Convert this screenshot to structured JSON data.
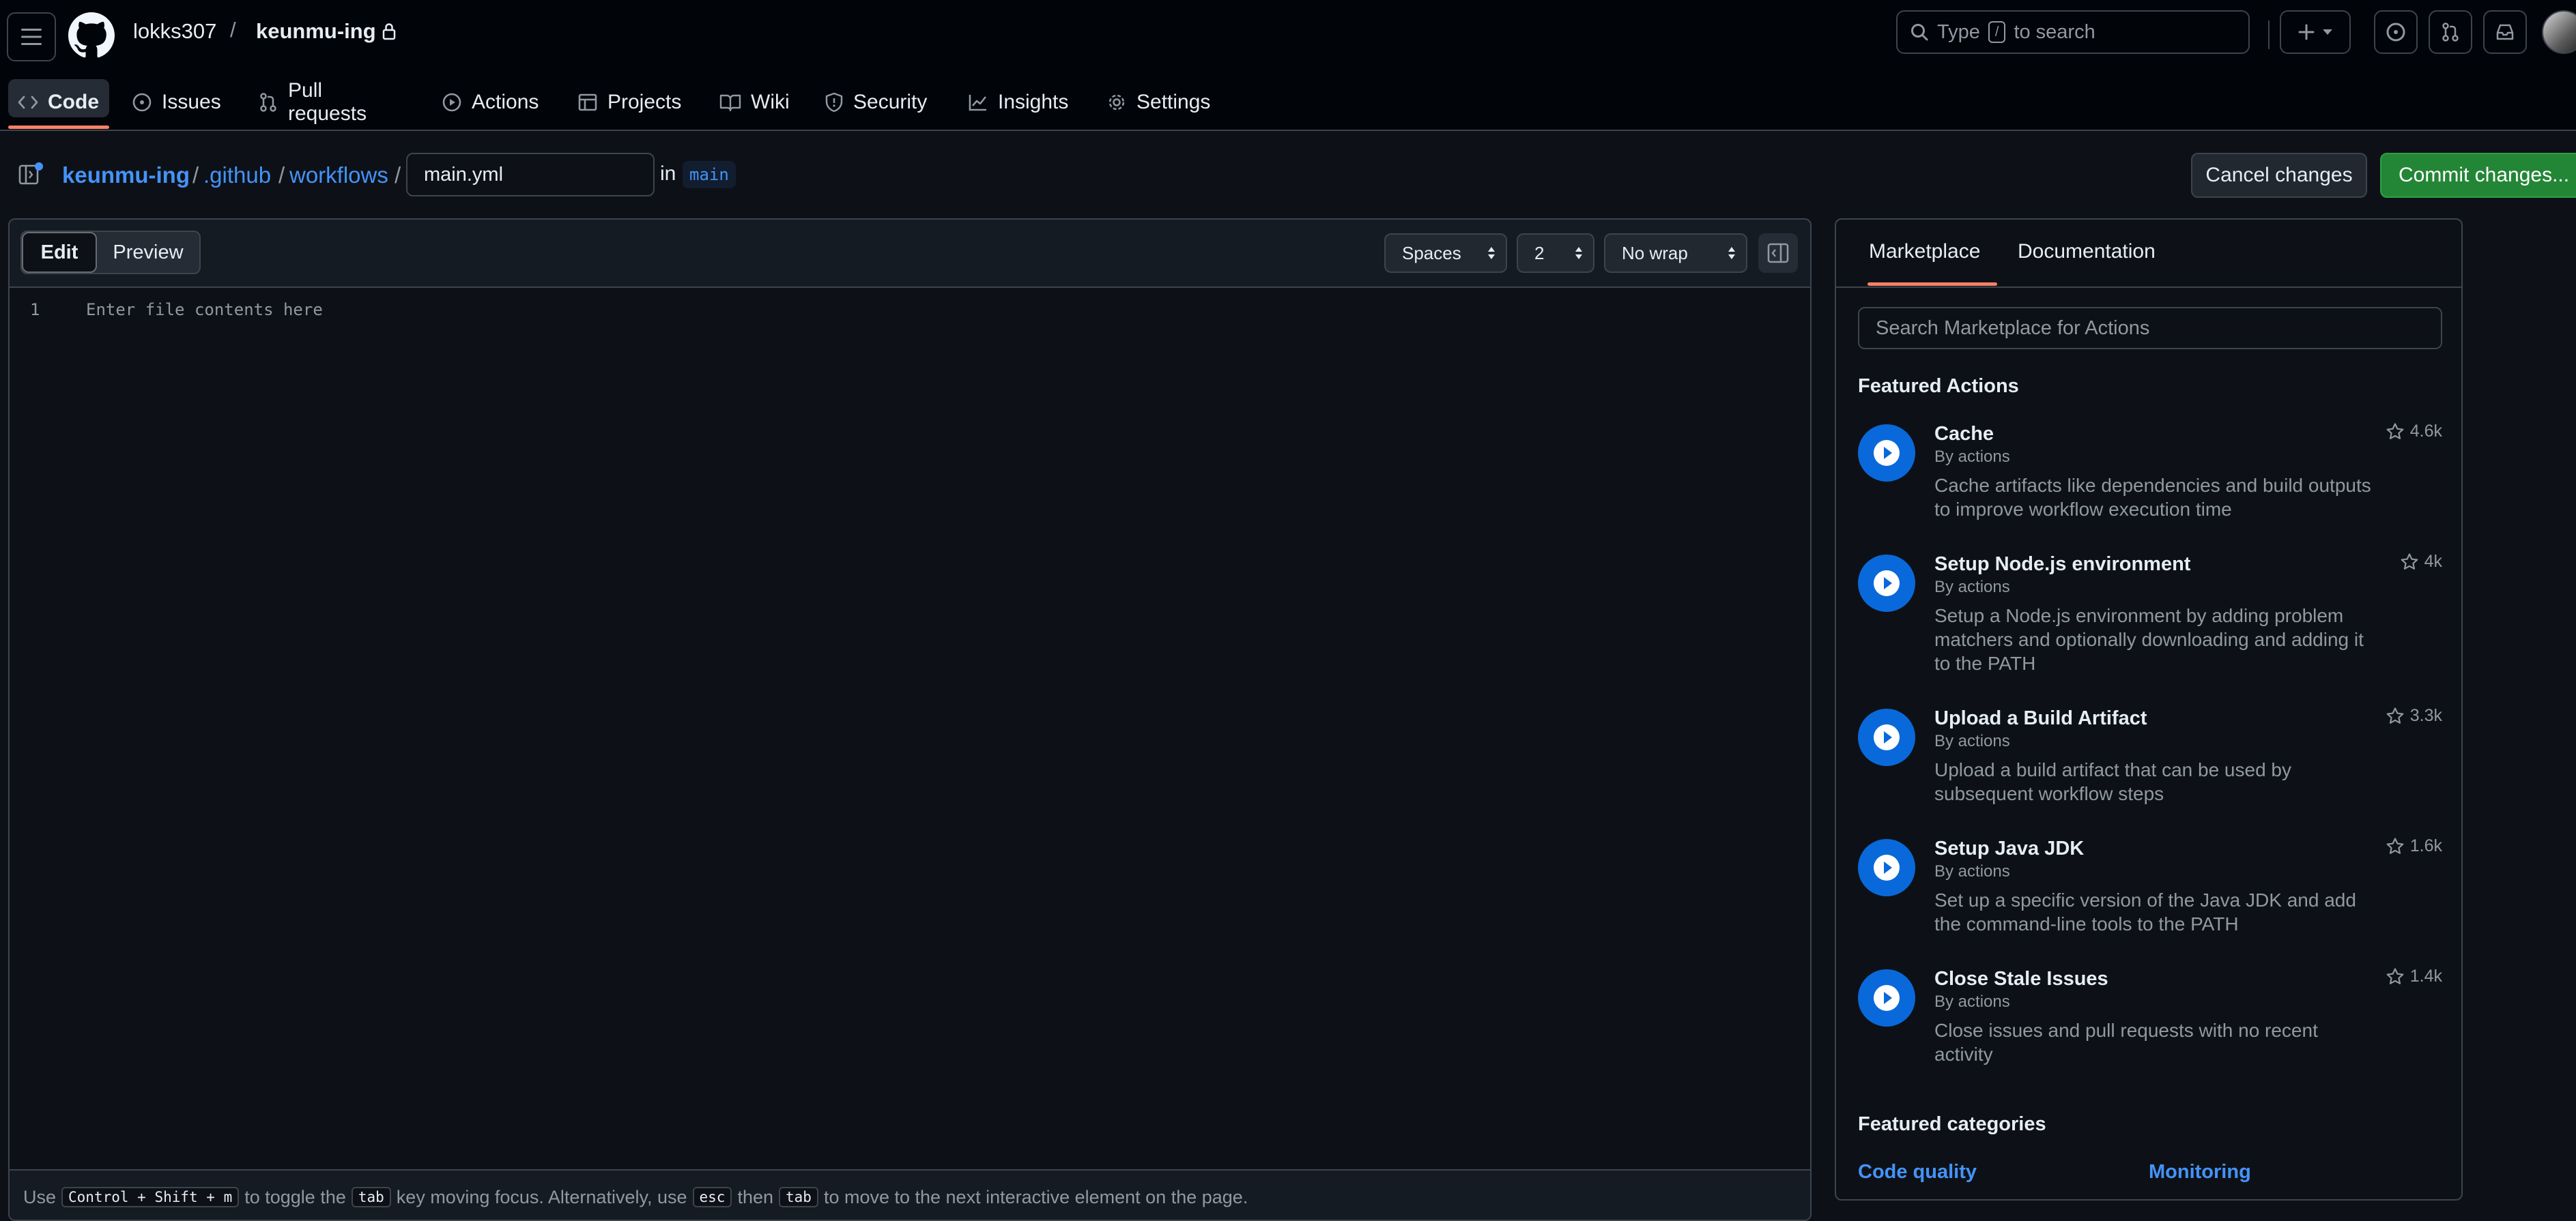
{
  "header": {
    "owner": "lokks307",
    "separator": "/",
    "repo": "keunmu-ing",
    "search_placeholder": "Type",
    "search_key": "/",
    "search_suffix": "to search"
  },
  "nav_tabs": [
    {
      "label": "Code",
      "icon": "code-icon"
    },
    {
      "label": "Issues",
      "icon": "issue-icon"
    },
    {
      "label": "Pull requests",
      "icon": "pull-request-icon"
    },
    {
      "label": "Actions",
      "icon": "play-icon"
    },
    {
      "label": "Projects",
      "icon": "table-icon"
    },
    {
      "label": "Wiki",
      "icon": "book-icon"
    },
    {
      "label": "Security",
      "icon": "shield-icon"
    },
    {
      "label": "Insights",
      "icon": "graph-icon"
    },
    {
      "label": "Settings",
      "icon": "gear-icon"
    }
  ],
  "breadcrumb": {
    "root": "keunmu-ing",
    "dir1": ".github",
    "dir2": "workflows",
    "sep": "/",
    "filename": "main.yml",
    "in_label": "in",
    "branch": "main"
  },
  "actions_bar": {
    "cancel": "Cancel changes",
    "commit": "Commit changes..."
  },
  "editor": {
    "edit_tab": "Edit",
    "preview_tab": "Preview",
    "indent_mode": "Spaces",
    "indent_size": "2",
    "wrap_mode": "No wrap",
    "line_number": "1",
    "placeholder": "Enter file contents here",
    "footer": {
      "t1": "Use",
      "k1": "Control + Shift + m",
      "t2": "to toggle the",
      "k2": "tab",
      "t3": "key moving focus. Alternatively, use",
      "k3": "esc",
      "t4": "then",
      "k4": "tab",
      "t5": "to move to the next interactive element on the page."
    }
  },
  "side_panel": {
    "tabs": [
      "Marketplace",
      "Documentation"
    ],
    "search_placeholder": "Search Marketplace for Actions",
    "featured_actions_title": "Featured Actions",
    "actions": [
      {
        "name": "Cache",
        "by": "By actions",
        "desc": "Cache artifacts like dependencies and build outputs to improve workflow execution time",
        "stars": "4.6k"
      },
      {
        "name": "Setup Node.js environment",
        "by": "By actions",
        "desc": "Setup a Node.js environment by adding problem matchers and optionally downloading and adding it to the PATH",
        "stars": "4k"
      },
      {
        "name": "Upload a Build Artifact",
        "by": "By actions",
        "desc": "Upload a build artifact that can be used by subsequent workflow steps",
        "stars": "3.3k"
      },
      {
        "name": "Setup Java JDK",
        "by": "By actions",
        "desc": "Set up a specific version of the Java JDK and add the command-line tools to the PATH",
        "stars": "1.6k"
      },
      {
        "name": "Close Stale Issues",
        "by": "By actions",
        "desc": "Close issues and pull requests with no recent activity",
        "stars": "1.4k"
      }
    ],
    "featured_categories_title": "Featured categories",
    "categories": [
      "Code quality",
      "Monitoring"
    ]
  },
  "colors": {
    "background": "#0d1117",
    "header_bg": "#010409",
    "accent_link": "#4493f8",
    "commit_green": "#238636",
    "tab_underline": "#f78166",
    "action_icon_blue": "#0969da"
  }
}
